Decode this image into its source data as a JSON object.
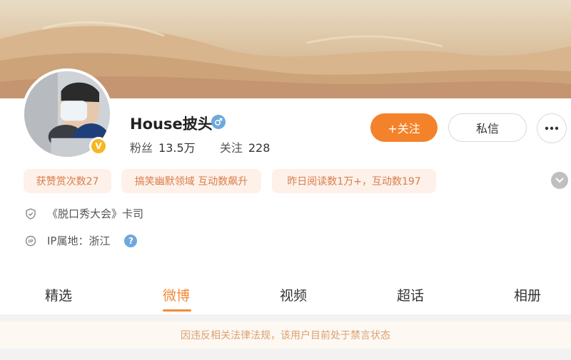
{
  "profile": {
    "name": "House披头",
    "verified_badge": "V",
    "stats": {
      "followers_label": "粉丝",
      "followers_value": "13.5万",
      "following_label": "关注",
      "following_value": "228"
    }
  },
  "actions": {
    "follow_label": "+关注",
    "message_label": "私信",
    "more_icon": "ellipsis-icon"
  },
  "tags": [
    "获赞赏次数27",
    "搞笑幽默领域 互动数飙升",
    "昨日阅读数1万+，互动数197"
  ],
  "info": {
    "credential": "《脱口秀大会》卡司",
    "ip_location": "IP属地：浙江",
    "help_glyph": "?"
  },
  "tabs": [
    {
      "label": "精选",
      "active": false
    },
    {
      "label": "微博",
      "active": true
    },
    {
      "label": "视频",
      "active": false
    },
    {
      "label": "超话",
      "active": false
    },
    {
      "label": "相册",
      "active": false
    }
  ],
  "notice": "因违反相关法律法规，该用户目前处于禁言状态",
  "colors": {
    "accent": "#f08b3a",
    "follow_button": "#f4822a",
    "tag_background": "#fdf1ea",
    "tag_text": "#d97d4a",
    "gender_icon": "#6fa8dc",
    "verified_badge": "#f5b822"
  }
}
